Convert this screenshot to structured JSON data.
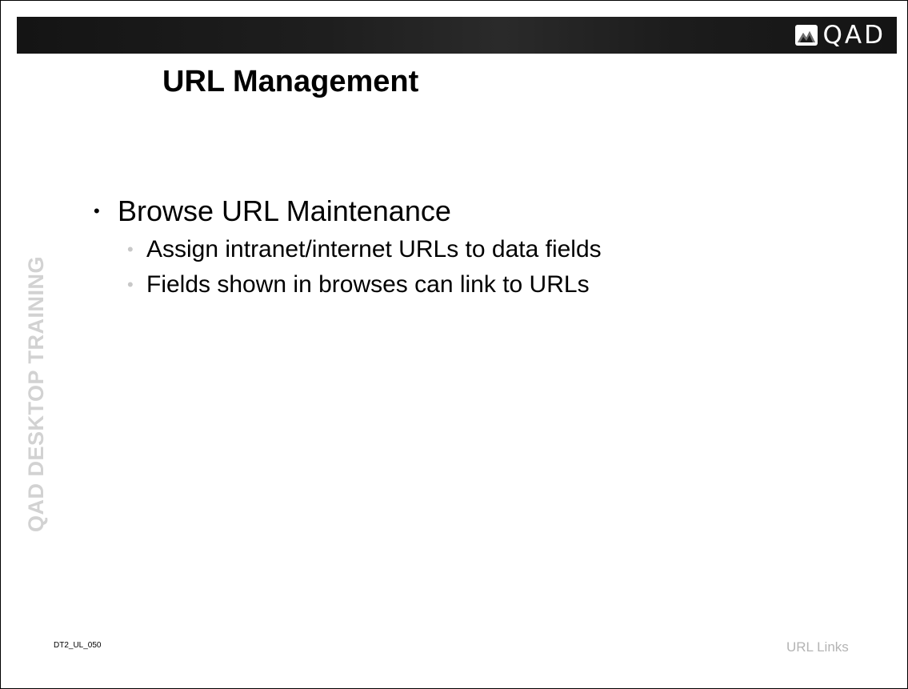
{
  "header": {
    "logo_text": "QAD",
    "logo_icon": "qad-logo-icon"
  },
  "slide": {
    "title": "URL Management",
    "side_label": "QAD DESKTOP TRAINING",
    "bullets": [
      {
        "text": "Browse URL Maintenance",
        "subitems": [
          "Assign intranet/internet URLs to data fields",
          "Fields shown in browses can link to URLs"
        ]
      }
    ]
  },
  "footer": {
    "code": "DT2_UL_050",
    "topic": "URL Links"
  }
}
